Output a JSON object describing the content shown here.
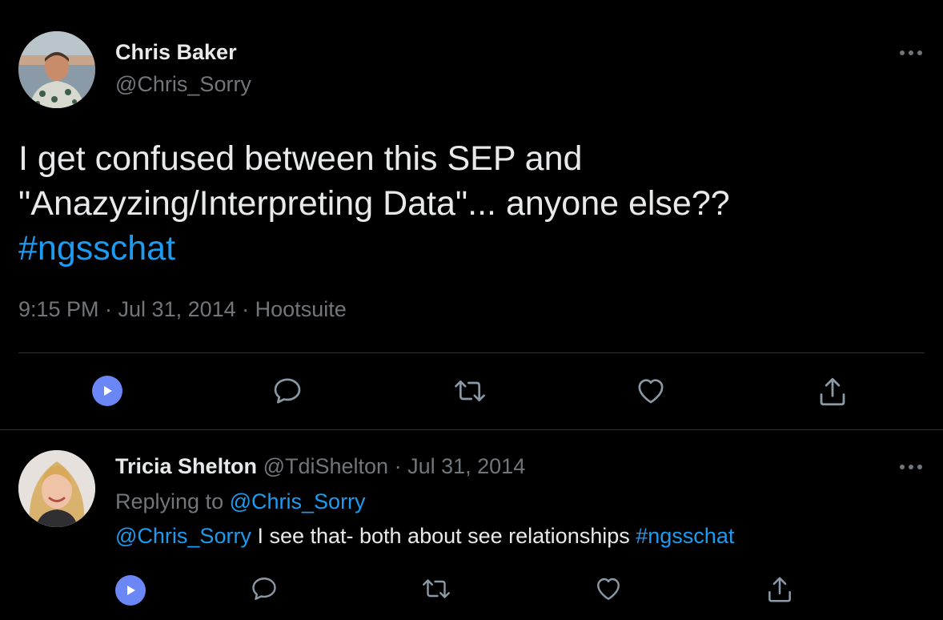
{
  "main_tweet": {
    "author_name": "Chris Baker",
    "author_handle": "@Chris_Sorry",
    "text_line1": "I get confused between this SEP and",
    "text_line2": "\"Anazyzing/Interpreting Data\"... anyone else??",
    "hashtag": "#ngsschat",
    "meta": "9:15 PM · Jul 31, 2014 · Hootsuite",
    "actions": [
      "play-icon",
      "reply-icon",
      "retweet-icon",
      "like-icon",
      "share-icon"
    ]
  },
  "reply_tweet": {
    "author_name": "Tricia Shelton",
    "author_handle": "@TdiShelton",
    "separator": "·",
    "date": "Jul 31, 2014",
    "replying_prefix": "Replying to",
    "replying_to": "@Chris_Sorry",
    "mention": "@Chris_Sorry",
    "text_body": " I see that- both about see relationships ",
    "hashtag": "#ngsschat",
    "actions": [
      "play-icon",
      "reply-icon",
      "retweet-icon",
      "like-icon",
      "share-icon"
    ]
  },
  "colors": {
    "background": "#000000",
    "text": "#e7e9ea",
    "secondary": "#71767b",
    "link": "#1d9bf0",
    "play_button": "#6a87f5",
    "divider": "#2f3336"
  }
}
